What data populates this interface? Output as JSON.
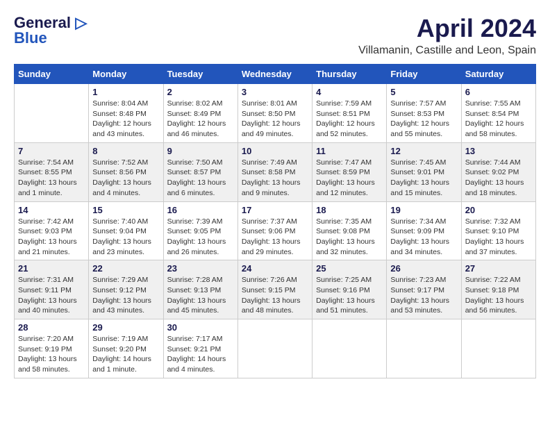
{
  "header": {
    "logo_line1": "General",
    "logo_line2": "Blue",
    "month": "April 2024",
    "location": "Villamanin, Castille and Leon, Spain"
  },
  "weekdays": [
    "Sunday",
    "Monday",
    "Tuesday",
    "Wednesday",
    "Thursday",
    "Friday",
    "Saturday"
  ],
  "weeks": [
    [
      {
        "day": "",
        "text": ""
      },
      {
        "day": "1",
        "text": "Sunrise: 8:04 AM\nSunset: 8:48 PM\nDaylight: 12 hours\nand 43 minutes."
      },
      {
        "day": "2",
        "text": "Sunrise: 8:02 AM\nSunset: 8:49 PM\nDaylight: 12 hours\nand 46 minutes."
      },
      {
        "day": "3",
        "text": "Sunrise: 8:01 AM\nSunset: 8:50 PM\nDaylight: 12 hours\nand 49 minutes."
      },
      {
        "day": "4",
        "text": "Sunrise: 7:59 AM\nSunset: 8:51 PM\nDaylight: 12 hours\nand 52 minutes."
      },
      {
        "day": "5",
        "text": "Sunrise: 7:57 AM\nSunset: 8:53 PM\nDaylight: 12 hours\nand 55 minutes."
      },
      {
        "day": "6",
        "text": "Sunrise: 7:55 AM\nSunset: 8:54 PM\nDaylight: 12 hours\nand 58 minutes."
      }
    ],
    [
      {
        "day": "7",
        "text": "Sunrise: 7:54 AM\nSunset: 8:55 PM\nDaylight: 13 hours\nand 1 minute."
      },
      {
        "day": "8",
        "text": "Sunrise: 7:52 AM\nSunset: 8:56 PM\nDaylight: 13 hours\nand 4 minutes."
      },
      {
        "day": "9",
        "text": "Sunrise: 7:50 AM\nSunset: 8:57 PM\nDaylight: 13 hours\nand 6 minutes."
      },
      {
        "day": "10",
        "text": "Sunrise: 7:49 AM\nSunset: 8:58 PM\nDaylight: 13 hours\nand 9 minutes."
      },
      {
        "day": "11",
        "text": "Sunrise: 7:47 AM\nSunset: 8:59 PM\nDaylight: 13 hours\nand 12 minutes."
      },
      {
        "day": "12",
        "text": "Sunrise: 7:45 AM\nSunset: 9:01 PM\nDaylight: 13 hours\nand 15 minutes."
      },
      {
        "day": "13",
        "text": "Sunrise: 7:44 AM\nSunset: 9:02 PM\nDaylight: 13 hours\nand 18 minutes."
      }
    ],
    [
      {
        "day": "14",
        "text": "Sunrise: 7:42 AM\nSunset: 9:03 PM\nDaylight: 13 hours\nand 21 minutes."
      },
      {
        "day": "15",
        "text": "Sunrise: 7:40 AM\nSunset: 9:04 PM\nDaylight: 13 hours\nand 23 minutes."
      },
      {
        "day": "16",
        "text": "Sunrise: 7:39 AM\nSunset: 9:05 PM\nDaylight: 13 hours\nand 26 minutes."
      },
      {
        "day": "17",
        "text": "Sunrise: 7:37 AM\nSunset: 9:06 PM\nDaylight: 13 hours\nand 29 minutes."
      },
      {
        "day": "18",
        "text": "Sunrise: 7:35 AM\nSunset: 9:08 PM\nDaylight: 13 hours\nand 32 minutes."
      },
      {
        "day": "19",
        "text": "Sunrise: 7:34 AM\nSunset: 9:09 PM\nDaylight: 13 hours\nand 34 minutes."
      },
      {
        "day": "20",
        "text": "Sunrise: 7:32 AM\nSunset: 9:10 PM\nDaylight: 13 hours\nand 37 minutes."
      }
    ],
    [
      {
        "day": "21",
        "text": "Sunrise: 7:31 AM\nSunset: 9:11 PM\nDaylight: 13 hours\nand 40 minutes."
      },
      {
        "day": "22",
        "text": "Sunrise: 7:29 AM\nSunset: 9:12 PM\nDaylight: 13 hours\nand 43 minutes."
      },
      {
        "day": "23",
        "text": "Sunrise: 7:28 AM\nSunset: 9:13 PM\nDaylight: 13 hours\nand 45 minutes."
      },
      {
        "day": "24",
        "text": "Sunrise: 7:26 AM\nSunset: 9:15 PM\nDaylight: 13 hours\nand 48 minutes."
      },
      {
        "day": "25",
        "text": "Sunrise: 7:25 AM\nSunset: 9:16 PM\nDaylight: 13 hours\nand 51 minutes."
      },
      {
        "day": "26",
        "text": "Sunrise: 7:23 AM\nSunset: 9:17 PM\nDaylight: 13 hours\nand 53 minutes."
      },
      {
        "day": "27",
        "text": "Sunrise: 7:22 AM\nSunset: 9:18 PM\nDaylight: 13 hours\nand 56 minutes."
      }
    ],
    [
      {
        "day": "28",
        "text": "Sunrise: 7:20 AM\nSunset: 9:19 PM\nDaylight: 13 hours\nand 58 minutes."
      },
      {
        "day": "29",
        "text": "Sunrise: 7:19 AM\nSunset: 9:20 PM\nDaylight: 14 hours\nand 1 minute."
      },
      {
        "day": "30",
        "text": "Sunrise: 7:17 AM\nSunset: 9:21 PM\nDaylight: 14 hours\nand 4 minutes."
      },
      {
        "day": "",
        "text": ""
      },
      {
        "day": "",
        "text": ""
      },
      {
        "day": "",
        "text": ""
      },
      {
        "day": "",
        "text": ""
      }
    ]
  ]
}
